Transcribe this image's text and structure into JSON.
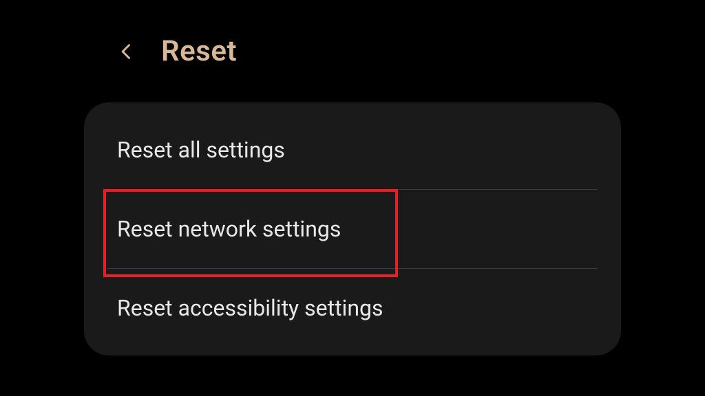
{
  "header": {
    "title": "Reset"
  },
  "list": {
    "items": [
      {
        "label": "Reset all settings"
      },
      {
        "label": "Reset network settings"
      },
      {
        "label": "Reset accessibility settings"
      }
    ]
  },
  "colors": {
    "accent": "#d8b897",
    "highlight": "#ed1c24"
  }
}
